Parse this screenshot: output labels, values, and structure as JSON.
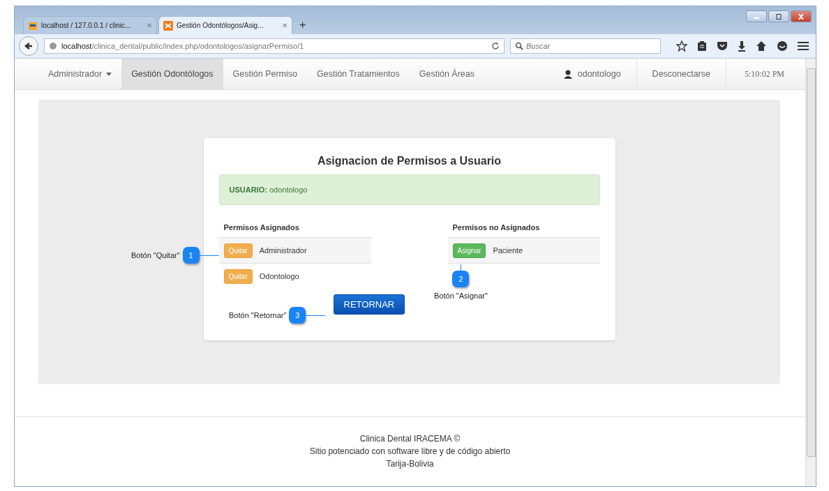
{
  "browser": {
    "tabs": [
      {
        "title": "localhost / 127.0.0.1 / clinic...",
        "close": "✕",
        "selected": false
      },
      {
        "title": "Gestión Odontólogos/Asig...",
        "close": "✕",
        "selected": true
      }
    ],
    "new_tab": "+",
    "url_host": "localhost",
    "url_path": "/clinica_dental/public/index.php/odontologos/asignarPermiso/1",
    "search": {
      "placeholder": "Buscar"
    }
  },
  "navbar": {
    "items": [
      {
        "label": "Administrador",
        "kind": "dropdown",
        "selected": false
      },
      {
        "label": "Gestión Odontólogos",
        "kind": "link",
        "selected": true
      },
      {
        "label": "Gestión Permiso",
        "kind": "link",
        "selected": false
      },
      {
        "label": "Gestión Tratamientos",
        "kind": "link",
        "selected": false
      },
      {
        "label": "Gestión Áreas",
        "kind": "link",
        "selected": false
      }
    ],
    "user": "odontologo",
    "logout": "Desconectarse",
    "time": "5:10:02 PM"
  },
  "card": {
    "title": "Asignacion de Permisos a Usuario",
    "alert": "**USUARIO:** odontologo",
    "assigned": {
      "heading": "Permisos Asignados",
      "items": [
        {
          "button": "Quitar",
          "name": "Administrador",
          "highlighted": true
        },
        {
          "button": "Quitar",
          "name": "Odontologo",
          "highlighted": false
        }
      ]
    },
    "unassigned": {
      "heading": "Permisos no Asignados",
      "items": [
        {
          "button": "Asignar",
          "name": "Paciente",
          "highlighted": true
        }
      ]
    },
    "return_button": "RETORNAR"
  },
  "annotations": [
    {
      "number": "1",
      "label": "Botón \"Quitar\""
    },
    {
      "number": "2",
      "label": "Botón \"Asignar\""
    },
    {
      "number": "3",
      "label": "Botón \"Retornar\""
    }
  ],
  "footer": [
    "Clinica Dental IRACEMA ©",
    "Sitio potenciado con software libre y de código abierto",
    "Tarija-Bolivia"
  ]
}
